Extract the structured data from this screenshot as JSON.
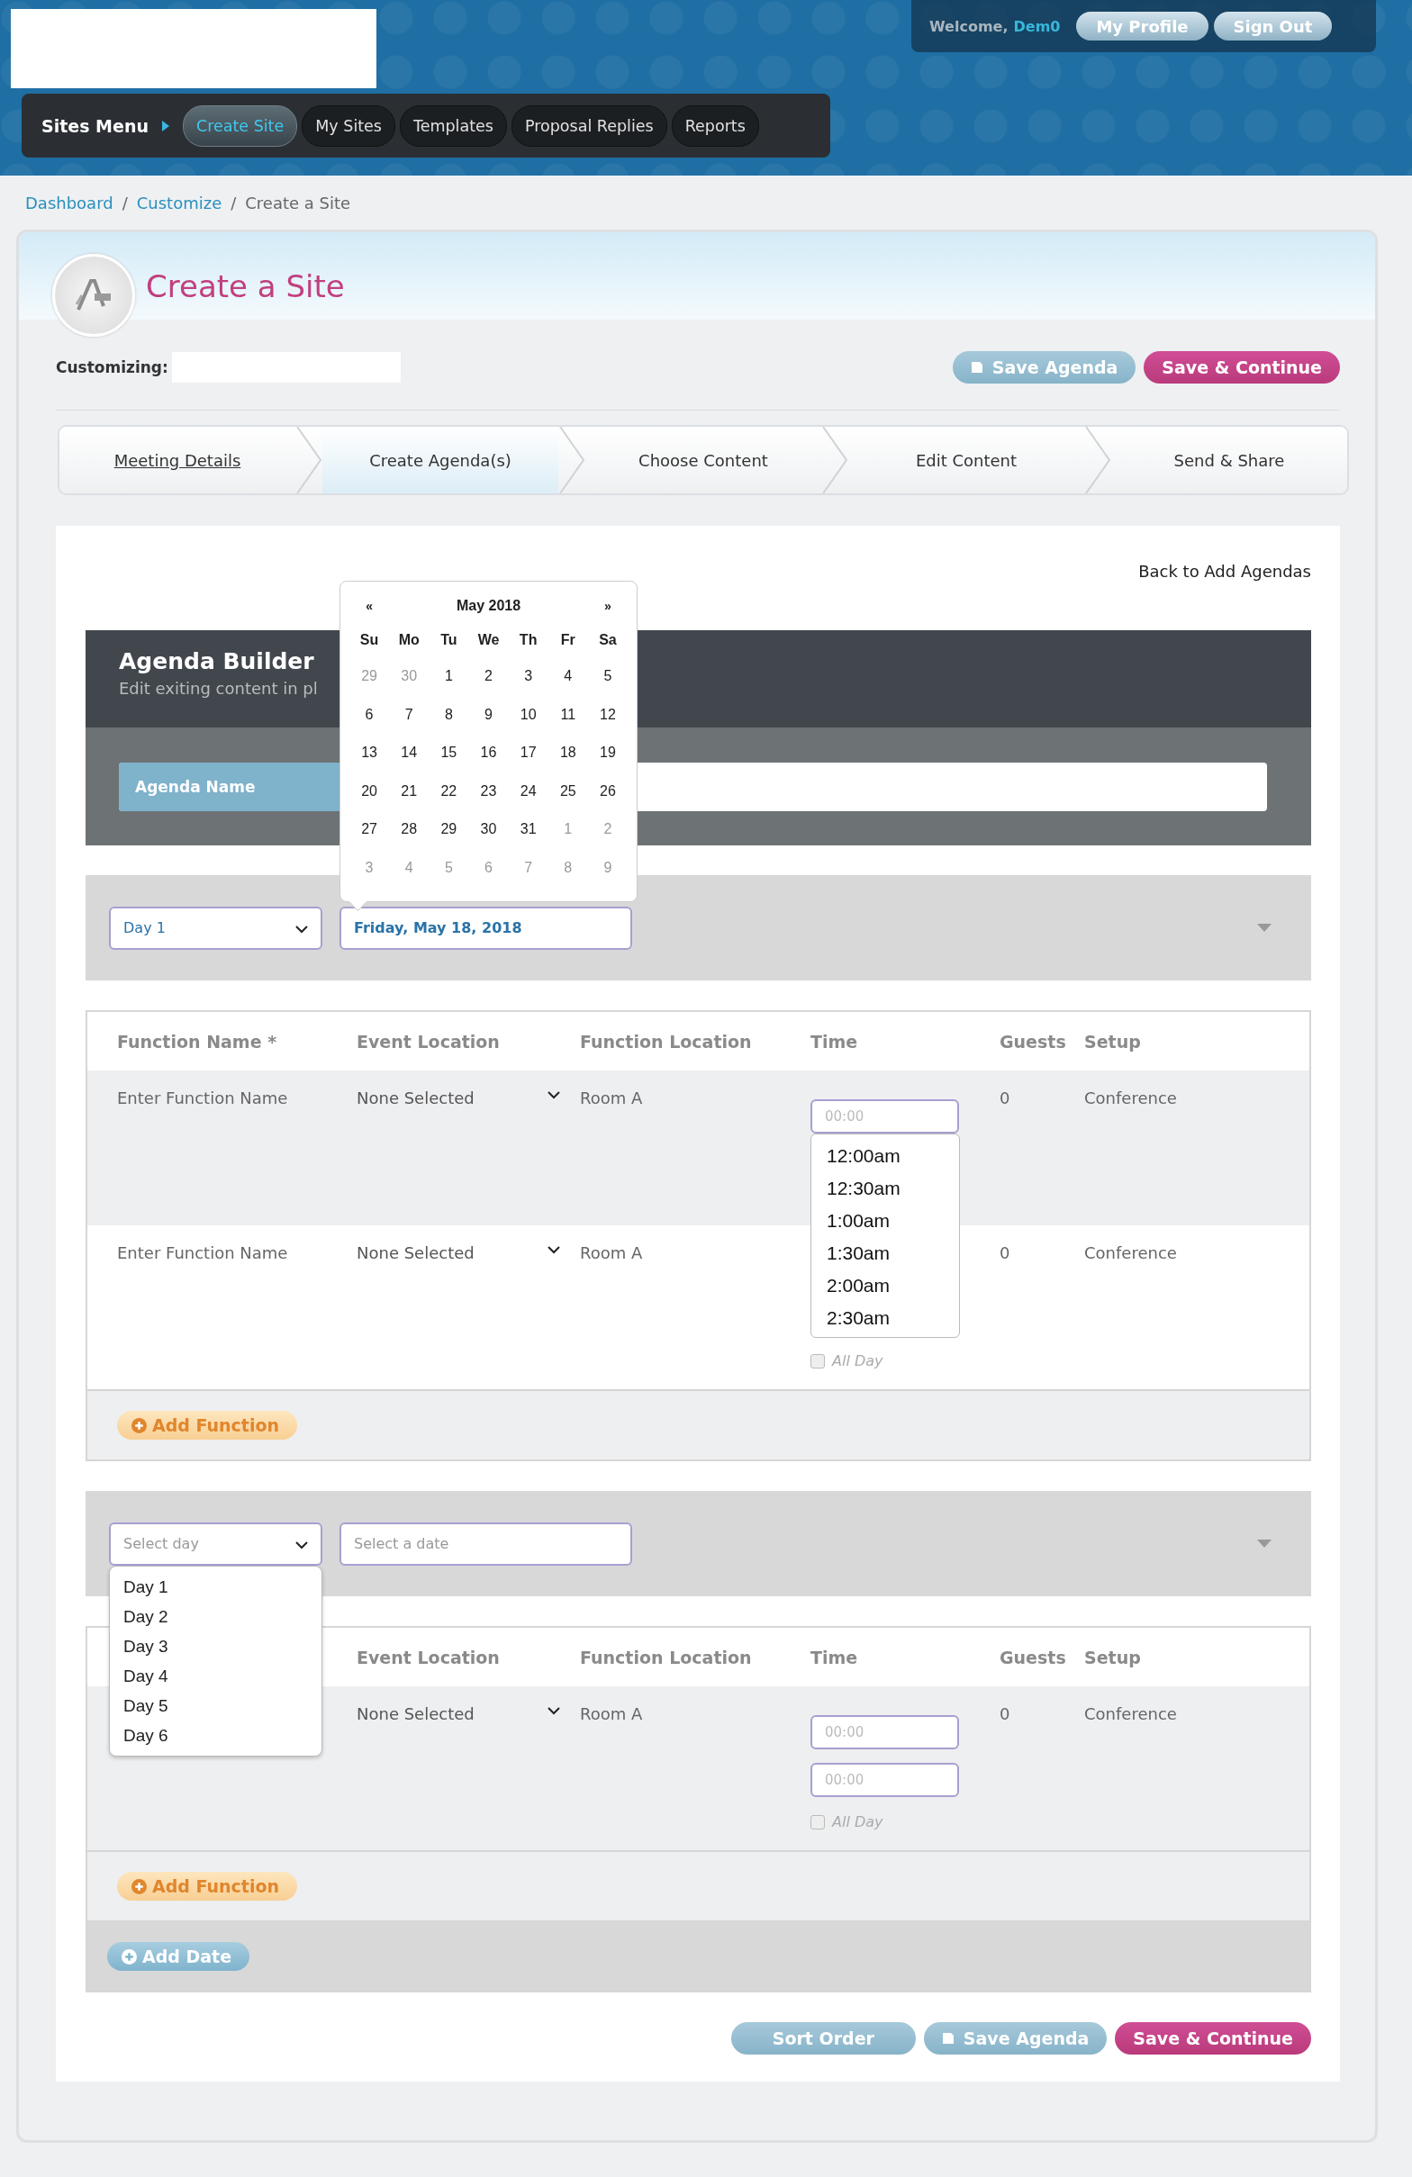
{
  "header": {
    "welcome": "Welcome,",
    "user": "Dem0",
    "buttons": [
      "My Profile",
      "Sign Out"
    ]
  },
  "nav": {
    "title": "Sites Menu",
    "items": [
      {
        "label": "Create Site",
        "selected": true
      },
      {
        "label": "My Sites",
        "selected": false
      },
      {
        "label": "Templates",
        "selected": false
      },
      {
        "label": "Proposal Replies",
        "selected": false
      },
      {
        "label": "Reports",
        "selected": false
      }
    ]
  },
  "breadcrumb": [
    {
      "label": "Dashboard",
      "kind": "link"
    },
    {
      "label": "/",
      "kind": "separator"
    },
    {
      "label": "Customize",
      "kind": "link"
    },
    {
      "label": "/",
      "kind": "separator"
    },
    {
      "label": "Create a Site",
      "kind": "current"
    }
  ],
  "page": {
    "title": "Create a Site",
    "customizing_label": "Customizing:",
    "actions": [
      {
        "label": "Save Agenda",
        "kind": "save"
      },
      {
        "label": "Save & Continue",
        "kind": "primary"
      }
    ]
  },
  "steps": [
    {
      "label": "Meeting Details",
      "selected": false,
      "done": true
    },
    {
      "label": "Create Agenda(s)",
      "selected": true,
      "done": false
    },
    {
      "label": "Choose Content",
      "selected": false,
      "done": false
    },
    {
      "label": "Edit Content",
      "selected": false,
      "done": false
    },
    {
      "label": "Send & Share",
      "selected": false,
      "done": false
    }
  ],
  "back_link": "Back to Add Agendas",
  "agenda_builder": {
    "title": "Agenda Builder",
    "subtitle": "Edit exiting content in pl",
    "name_label": "Agenda Name"
  },
  "calendar": {
    "prev": "«",
    "month": "May 2018",
    "next": "»",
    "weekdays": [
      "Su",
      "Mo",
      "Tu",
      "We",
      "Th",
      "Fr",
      "Sa"
    ],
    "days": [
      {
        "label": "29",
        "muted": true
      },
      {
        "label": "30",
        "muted": true
      },
      {
        "label": "1",
        "muted": false
      },
      {
        "label": "2",
        "muted": false
      },
      {
        "label": "3",
        "muted": false
      },
      {
        "label": "4",
        "muted": false
      },
      {
        "label": "5",
        "muted": false
      },
      {
        "label": "6",
        "muted": false
      },
      {
        "label": "7",
        "muted": false
      },
      {
        "label": "8",
        "muted": false
      },
      {
        "label": "9",
        "muted": false
      },
      {
        "label": "10",
        "muted": false
      },
      {
        "label": "11",
        "muted": false
      },
      {
        "label": "12",
        "muted": false
      },
      {
        "label": "13",
        "muted": false
      },
      {
        "label": "14",
        "muted": false
      },
      {
        "label": "15",
        "muted": false
      },
      {
        "label": "16",
        "muted": false
      },
      {
        "label": "17",
        "muted": false
      },
      {
        "label": "18",
        "muted": false
      },
      {
        "label": "19",
        "muted": false
      },
      {
        "label": "20",
        "muted": false
      },
      {
        "label": "21",
        "muted": false
      },
      {
        "label": "22",
        "muted": false
      },
      {
        "label": "23",
        "muted": false
      },
      {
        "label": "24",
        "muted": false
      },
      {
        "label": "25",
        "muted": false
      },
      {
        "label": "26",
        "muted": false
      },
      {
        "label": "27",
        "muted": false
      },
      {
        "label": "28",
        "muted": false
      },
      {
        "label": "29",
        "muted": false
      },
      {
        "label": "30",
        "muted": false
      },
      {
        "label": "31",
        "muted": false
      },
      {
        "label": "1",
        "muted": true
      },
      {
        "label": "2",
        "muted": true
      },
      {
        "label": "3",
        "muted": true
      },
      {
        "label": "4",
        "muted": true
      },
      {
        "label": "5",
        "muted": true
      },
      {
        "label": "6",
        "muted": true
      },
      {
        "label": "7",
        "muted": true
      },
      {
        "label": "8",
        "muted": true
      },
      {
        "label": "9",
        "muted": true
      }
    ]
  },
  "sections": [
    {
      "day_select": {
        "value": "Day 1"
      },
      "date_field": {
        "value": "Friday, May 18, 2018"
      },
      "columns": [
        {
          "kind": "name",
          "label": "Function Name *"
        },
        {
          "kind": "event",
          "label": "Event Location"
        },
        {
          "kind": "location",
          "label": "Function Location"
        },
        {
          "kind": "time",
          "label": "Time"
        },
        {
          "kind": "guests",
          "label": "Guests"
        },
        {
          "kind": "setup",
          "label": "Setup"
        }
      ],
      "rows": [
        {
          "name": "Enter Function Name",
          "event": "None Selected",
          "location": "Room A",
          "times": [
            {
              "placeholder": "00:00"
            }
          ],
          "time_options": [
            "12:00am",
            "12:30am",
            "1:00am",
            "1:30am",
            "2:00am",
            "2:30am"
          ],
          "guests": "0",
          "setup": "Conference"
        },
        {
          "name": "Enter Function Name",
          "event": "None Selected",
          "location": "Room A",
          "all_day": {
            "label": "All Day",
            "checked": false
          },
          "guests": "0",
          "setup": "Conference"
        }
      ],
      "add_function": "Add Function"
    },
    {
      "day_select": {
        "placeholder": "Select day",
        "options": [
          "Day 1",
          "Day 2",
          "Day 3",
          "Day 4",
          "Day 5",
          "Day 6"
        ]
      },
      "date_field": {
        "placeholder": "Select a date"
      },
      "columns": [
        {
          "kind": "event",
          "label": "Event Location"
        },
        {
          "kind": "location",
          "label": "Function Location"
        },
        {
          "kind": "time",
          "label": "Time"
        },
        {
          "kind": "guests",
          "label": "Guests"
        },
        {
          "kind": "setup",
          "label": "Setup"
        }
      ],
      "rows": [
        {
          "event": "None Selected",
          "location": "Room A",
          "times": [
            {
              "placeholder": "00:00"
            },
            {
              "placeholder": "00:00"
            }
          ],
          "all_day": {
            "label": "All Day",
            "checked": false
          },
          "guests": "0",
          "setup": "Conference"
        }
      ],
      "add_function": "Add Function"
    }
  ],
  "add_date": "Add Date",
  "footer_actions": [
    {
      "label": "Sort Order",
      "kind": "plain"
    },
    {
      "label": "Save Agenda",
      "kind": "save"
    },
    {
      "label": "Save & Continue",
      "kind": "primary"
    }
  ]
}
